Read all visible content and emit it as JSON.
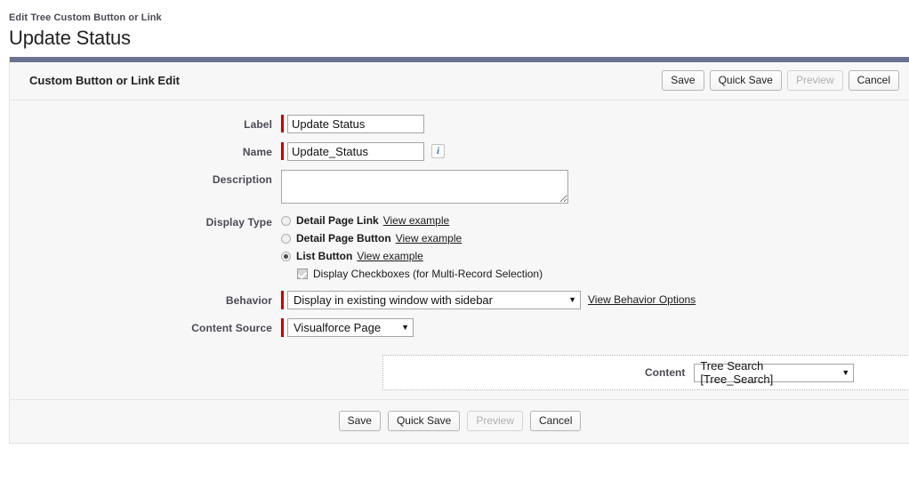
{
  "header": {
    "breadcrumb": "Edit Tree Custom Button or Link",
    "title": "Update Status"
  },
  "panel": {
    "heading": "Custom Button or Link Edit",
    "accent_color": "#6a7191",
    "required_marker_color": "#c00000"
  },
  "toolbar": {
    "save_label": "Save",
    "quick_save_label": "Quick Save",
    "preview_label": "Preview",
    "cancel_label": "Cancel"
  },
  "form": {
    "label_field": {
      "label": "Label",
      "value": "Update Status",
      "required": true
    },
    "name_field": {
      "label": "Name",
      "value": "Update_Status",
      "required": true,
      "info_icon": "info-icon",
      "info_glyph": "i"
    },
    "description_field": {
      "label": "Description",
      "value": "",
      "placeholder": ""
    },
    "display_type": {
      "label": "Display Type",
      "options": [
        {
          "text": "Detail Page Link",
          "link": "View example",
          "selected": false
        },
        {
          "text": "Detail Page Button",
          "link": "View example",
          "selected": false
        },
        {
          "text": "List Button",
          "link": "View example",
          "selected": true
        }
      ],
      "checkbox": {
        "label": "Display Checkboxes (for Multi-Record Selection)",
        "checked": true
      }
    },
    "behavior": {
      "label": "Behavior",
      "value": "Display in existing window with sidebar",
      "link": "View Behavior Options",
      "required": true,
      "caret": "▼"
    },
    "content_source": {
      "label": "Content Source",
      "value": "Visualforce Page",
      "required": true,
      "caret": "▼"
    },
    "content": {
      "label": "Content",
      "value": "Tree Search [Tree_Search]",
      "caret": "▼"
    }
  },
  "footer": {
    "save_label": "Save",
    "quick_save_label": "Quick Save",
    "preview_label": "Preview",
    "cancel_label": "Cancel"
  }
}
